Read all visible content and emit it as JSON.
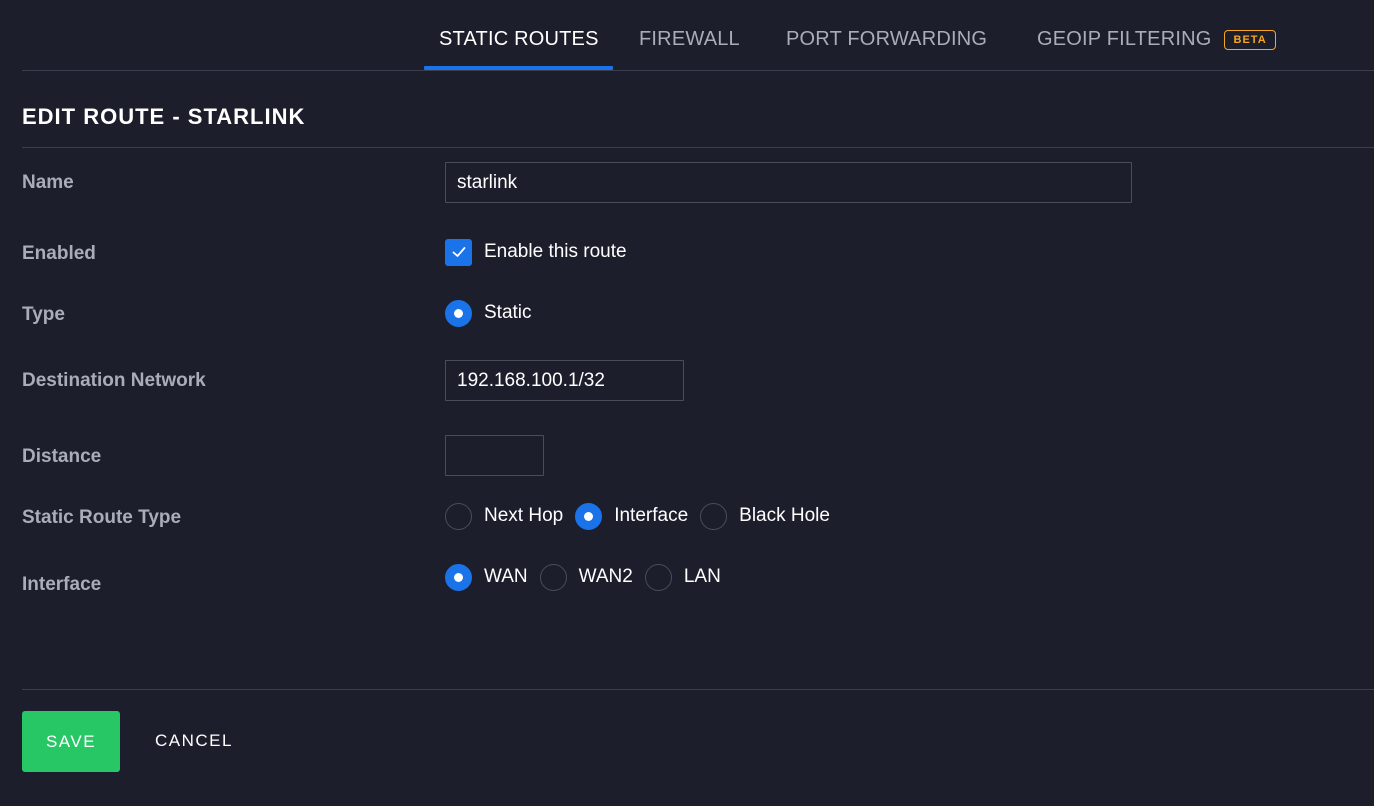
{
  "tabs": [
    {
      "label": "STATIC ROUTES",
      "active": true
    },
    {
      "label": "FIREWALL",
      "active": false
    },
    {
      "label": "PORT FORWARDING",
      "active": false
    },
    {
      "label": "GEOIP FILTERING",
      "active": false,
      "badge": "BETA"
    }
  ],
  "section_title": "EDIT ROUTE - STARLINK",
  "form": {
    "name": {
      "label": "Name",
      "value": "starlink"
    },
    "enabled": {
      "label": "Enabled",
      "checkbox_label": "Enable this route",
      "checked": true
    },
    "type": {
      "label": "Type",
      "options": [
        {
          "label": "Static",
          "selected": true
        }
      ]
    },
    "destination": {
      "label": "Destination Network",
      "value": "192.168.100.1/32"
    },
    "distance": {
      "label": "Distance",
      "value": ""
    },
    "static_route_type": {
      "label": "Static Route Type",
      "options": [
        {
          "label": "Next Hop",
          "selected": false
        },
        {
          "label": "Interface",
          "selected": true
        },
        {
          "label": "Black Hole",
          "selected": false
        }
      ]
    },
    "interface": {
      "label": "Interface",
      "options": [
        {
          "label": "WAN",
          "selected": true
        },
        {
          "label": "WAN2",
          "selected": false
        },
        {
          "label": "LAN",
          "selected": false
        }
      ]
    }
  },
  "buttons": {
    "save": "SAVE",
    "cancel": "CANCEL"
  },
  "colors": {
    "accent": "#1a73e8",
    "save": "#27c766",
    "beta": "#f5a623",
    "background": "#1c1e2b"
  }
}
